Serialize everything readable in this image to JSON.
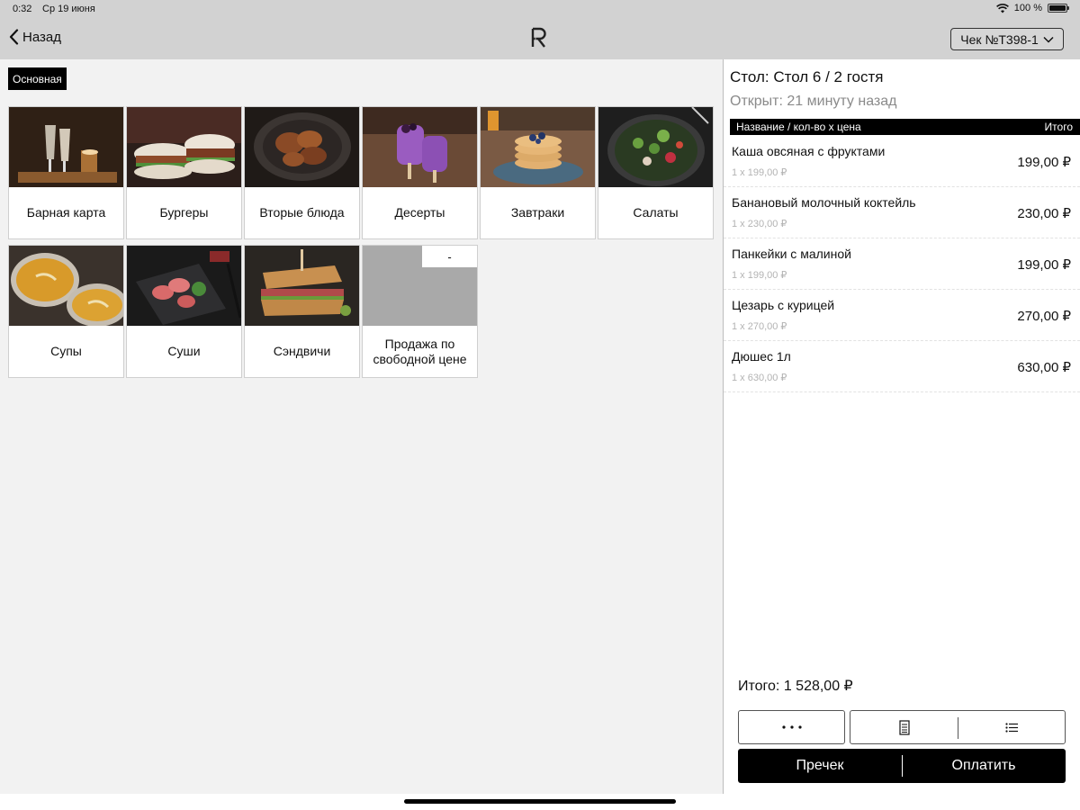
{
  "status_bar": {
    "time": "0:32",
    "date": "Ср 19 июня",
    "battery": "100 %",
    "battery_level": 1.0
  },
  "nav": {
    "back_label": "Назад",
    "logo_icon": "R-logo-icon",
    "check_label": "Чек №T398-1"
  },
  "menu": {
    "active_tab": "Основная",
    "categories": [
      {
        "label": "Барная карта",
        "image": "cocktails-photo"
      },
      {
        "label": "Бургеры",
        "image": "burgers-photo"
      },
      {
        "label": "Вторые блюда",
        "image": "main-dish-photo"
      },
      {
        "label": "Десерты",
        "image": "dessert-photo"
      },
      {
        "label": "Завтраки",
        "image": "pancakes-photo"
      },
      {
        "label": "Салаты",
        "image": "salad-photo"
      },
      {
        "label": "Супы",
        "image": "soup-photo"
      },
      {
        "label": "Суши",
        "image": "sushi-photo"
      },
      {
        "label": "Сэндвичи",
        "image": "sandwich-photo"
      },
      {
        "label": "Продажа по свободной цене",
        "image": "placeholder",
        "badge": "-"
      }
    ]
  },
  "order": {
    "table": "Стол: Стол 6 / 2 гостя",
    "opened": "Открыт: 21 минуту назад",
    "header_left": "Название / кол-во x цена",
    "header_right": "Итого",
    "items": [
      {
        "name": "Каша овсяная с фруктами",
        "qty": "1 x 199,00 ₽",
        "total": "199,00 ₽"
      },
      {
        "name": "Банановый молочный коктейль",
        "qty": "1 x 230,00 ₽",
        "total": "230,00 ₽"
      },
      {
        "name": "Панкейки с малиной",
        "qty": "1 x 199,00 ₽",
        "total": "199,00 ₽"
      },
      {
        "name": "Цезарь с курицей",
        "qty": "1 x 270,00 ₽",
        "total": "270,00 ₽"
      },
      {
        "name": "Дюшес 1л",
        "qty": "1 x 630,00 ₽",
        "total": "630,00 ₽"
      }
    ],
    "total": "Итого: 1 528,00 ₽",
    "precheck_label": "Пречек",
    "pay_label": "Оплатить"
  },
  "colors": {
    "topbar": "#d2d2d2",
    "menu_background": "#f2f2f2",
    "accent": "#000000"
  }
}
